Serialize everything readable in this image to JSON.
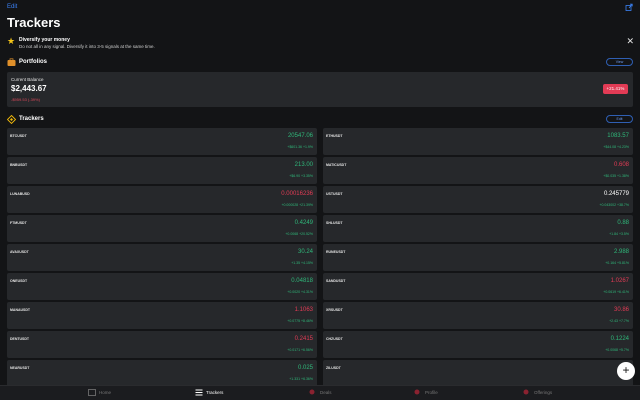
{
  "header": {
    "edit_label": "Edit",
    "title": "Trackers"
  },
  "tip": {
    "title": "Diversify your money",
    "text": "Do not all in any signal. Diversify it into 3-5 signals at the same time."
  },
  "portfolio_section": {
    "title": "Portfolios",
    "button_label": "View"
  },
  "balance": {
    "label": "Current Balance",
    "value": "$2,443.67",
    "change": "-$959.53 (-39%)",
    "badge": "+21.41%"
  },
  "trackers_section": {
    "title": "Trackers",
    "button_label": "Edit"
  },
  "trackers": [
    {
      "symbol": "BTCUSDT",
      "price": "20547.06",
      "change": "+$601.36 +1.9%",
      "trend": "up"
    },
    {
      "symbol": "ETHUSDT",
      "price": "1083.57",
      "change": "+$44.08 +4.23%",
      "trend": "up"
    },
    {
      "symbol": "BNBUSDT",
      "price": "213.00",
      "change": "+$6.90 +3.35%",
      "trend": "up"
    },
    {
      "symbol": "MATICUSDT",
      "price": "0.608",
      "change": "+$0.035 +1.38%",
      "trend": "down"
    },
    {
      "symbol": "LUNABUSD",
      "price": "0.00016236",
      "change": "+0.000028 +21.39%",
      "trend": "down"
    },
    {
      "symbol": "USTUSDT",
      "price": "0.245779",
      "change": "+0.043002 +38.7%",
      "trend": "neutral"
    },
    {
      "symbol": "FTMUSDT",
      "price": "0.4249",
      "change": "+0.0068 +20.52%",
      "trend": "up"
    },
    {
      "symbol": "SHLUSDT",
      "price": "0.88",
      "change": "+1.84 +3.5%",
      "trend": "up"
    },
    {
      "symbol": "AVAXUSDT",
      "price": "30.24",
      "change": "+1.35 +4.15%",
      "trend": "up"
    },
    {
      "symbol": "RUNEUSDT",
      "price": "2.988",
      "change": "+0.164 +5.81%",
      "trend": "up"
    },
    {
      "symbol": "ONEUSDT",
      "price": "0.04818",
      "change": "+0.0020 +4.31%",
      "trend": "up"
    },
    {
      "symbol": "SANDUSDT",
      "price": "1.0267",
      "change": "+0.0619 +6.41%",
      "trend": "down"
    },
    {
      "symbol": "MANAUSDT",
      "price": "1.1063",
      "change": "+0.0775 +8.46%",
      "trend": "down"
    },
    {
      "symbol": "XRSUSDT",
      "price": "30.86",
      "change": "+2.43 +7.7%",
      "trend": "down"
    },
    {
      "symbol": "DENTUSDT",
      "price": "0.2415",
      "change": "+0.0171 +6.56%",
      "trend": "down"
    },
    {
      "symbol": "CHZUSDT",
      "price": "0.1224",
      "change": "+0.0068 +5.7%",
      "trend": "up"
    },
    {
      "symbol": "NEARUSDT",
      "price": "0.025",
      "change": "+1.331 +6.36%",
      "trend": "up"
    },
    {
      "symbol": "ZILUSDT",
      "price": "0.0",
      "change": "",
      "trend": "down"
    }
  ],
  "tabs": [
    {
      "label": "Home",
      "icon": "home-icon",
      "active": false
    },
    {
      "label": "Trackers",
      "icon": "list-icon",
      "active": true
    },
    {
      "label": "Deals",
      "icon": "deals-icon",
      "active": false
    },
    {
      "label": "Profile",
      "icon": "profile-icon",
      "active": false
    },
    {
      "label": "Offerings",
      "icon": "offerings-icon",
      "active": false
    }
  ],
  "colors": {
    "up": "#2fb87a",
    "down": "#e23b55",
    "accent": "#3b82f6",
    "card": "#26282b",
    "background": "#131416"
  }
}
